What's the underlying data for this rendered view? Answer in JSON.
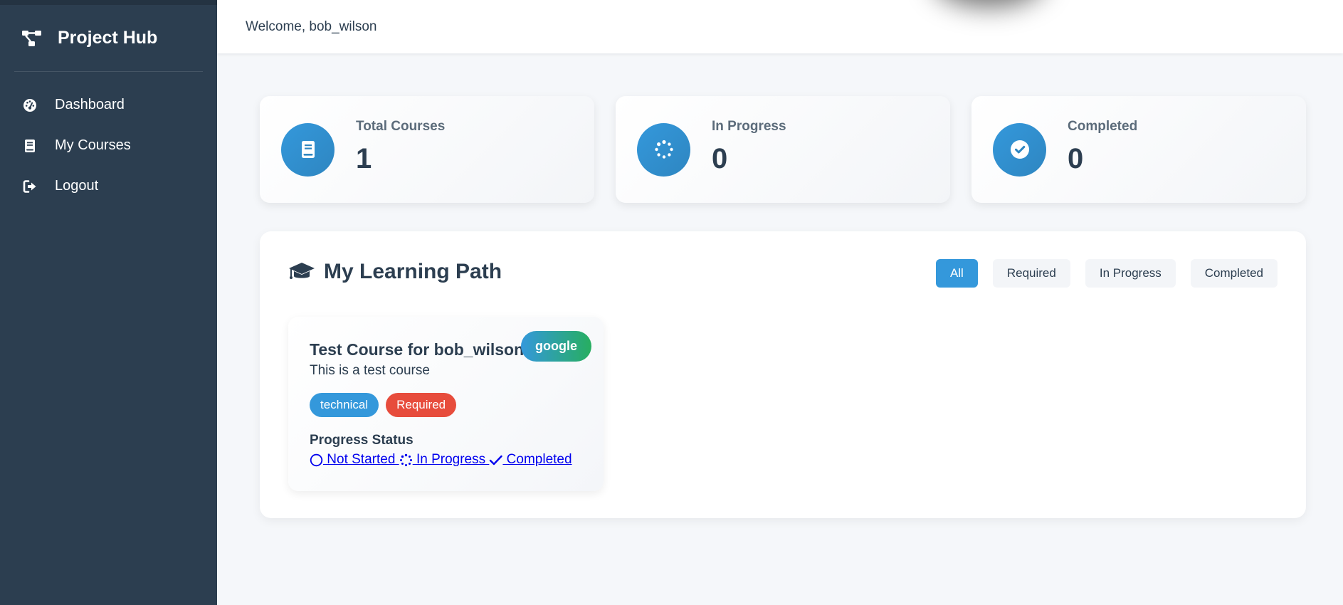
{
  "sidebar": {
    "brand": {
      "title": "Project Hub",
      "icon": "project-diagram-icon"
    },
    "items": [
      {
        "label": "Dashboard",
        "icon": "tachometer-icon"
      },
      {
        "label": "My Courses",
        "icon": "book-icon"
      },
      {
        "label": "Logout",
        "icon": "sign-out-icon"
      }
    ]
  },
  "header": {
    "welcome": "Welcome, bob_wilson"
  },
  "stats": [
    {
      "label": "Total Courses",
      "value": "1",
      "icon": "book-icon"
    },
    {
      "label": "In Progress",
      "value": "0",
      "icon": "spinner-icon"
    },
    {
      "label": "Completed",
      "value": "0",
      "icon": "check-circle-icon"
    }
  ],
  "learning_path": {
    "title": "My Learning Path",
    "icon": "graduation-cap-icon",
    "filters": [
      {
        "label": "All",
        "active": true
      },
      {
        "label": "Required",
        "active": false
      },
      {
        "label": "In Progress",
        "active": false
      },
      {
        "label": "Completed",
        "active": false
      }
    ],
    "courses": [
      {
        "title": "Test Course for bob_wilson",
        "provider": "google",
        "description": "This is a test course",
        "tags": [
          "technical",
          "Required"
        ],
        "progress_label": "Progress Status",
        "status_options": [
          {
            "label": " Not Started ",
            "icon": "circle-icon"
          },
          {
            "label": " In Progress ",
            "icon": "spinner-icon"
          },
          {
            "label": " Completed",
            "icon": "check-icon"
          }
        ]
      }
    ]
  },
  "colors": {
    "sidebar_bg": "#2c3e50",
    "accent": "#3498db",
    "required": "#e74c3c",
    "provider_gradient_end": "#27ae60",
    "link": "#0000ee"
  }
}
